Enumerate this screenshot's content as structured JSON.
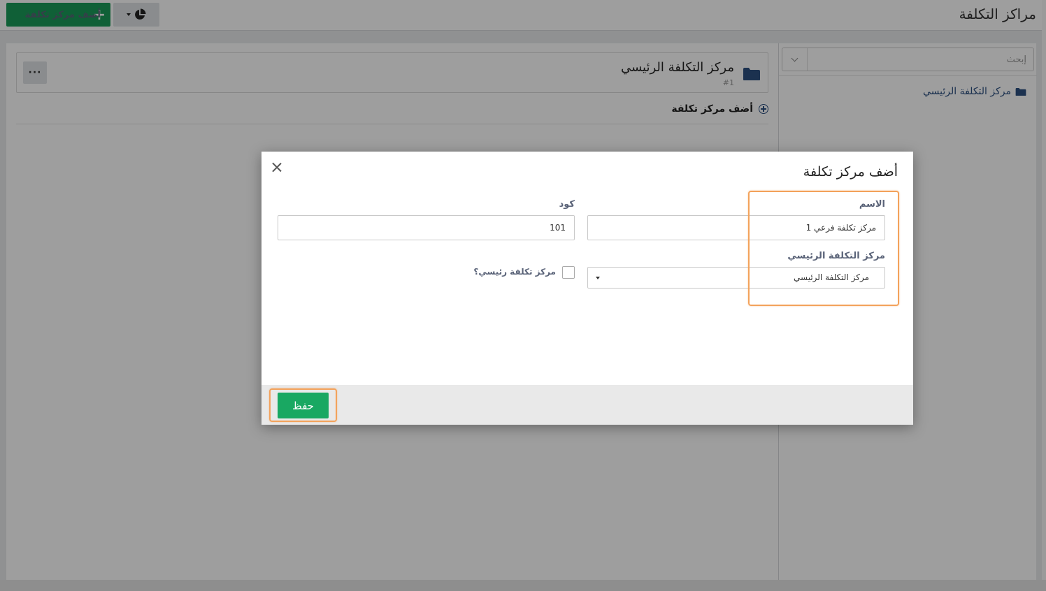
{
  "header": {
    "title": "مراكز التكلفة",
    "add_button_label": "أضف مركز تكلفة",
    "add_button_icon": "plus-icon",
    "chart_button_icon": "pie-chart-icon"
  },
  "sidebar": {
    "search_placeholder": "إبحث",
    "tree": [
      {
        "label": "مركز التكلفة الرئيسي",
        "icon": "folder-icon"
      }
    ]
  },
  "main": {
    "card": {
      "name": "مركز التكلفة الرئيسي",
      "number": "#1",
      "more_label": "···"
    },
    "add_link_label": "أضف مركز تكلفة"
  },
  "modal": {
    "title": "أضف مركز تكلفة",
    "name_label": "الاسم",
    "name_value": "مركز تكلفة فرعي 1",
    "code_label": "كود",
    "code_value": "101",
    "parent_label": "مركز التكلفة الرئيسي",
    "parent_value": "مركز التكلفة الرئيسي",
    "is_main_label": "مركز تكلفة رئيسي؟",
    "is_main_checked": false,
    "save_label": "حفظ"
  },
  "colors": {
    "primary_green": "#1a9c5a",
    "save_green": "#19a862",
    "highlight": "#f3a25b",
    "folder_blue": "#2d5080"
  }
}
